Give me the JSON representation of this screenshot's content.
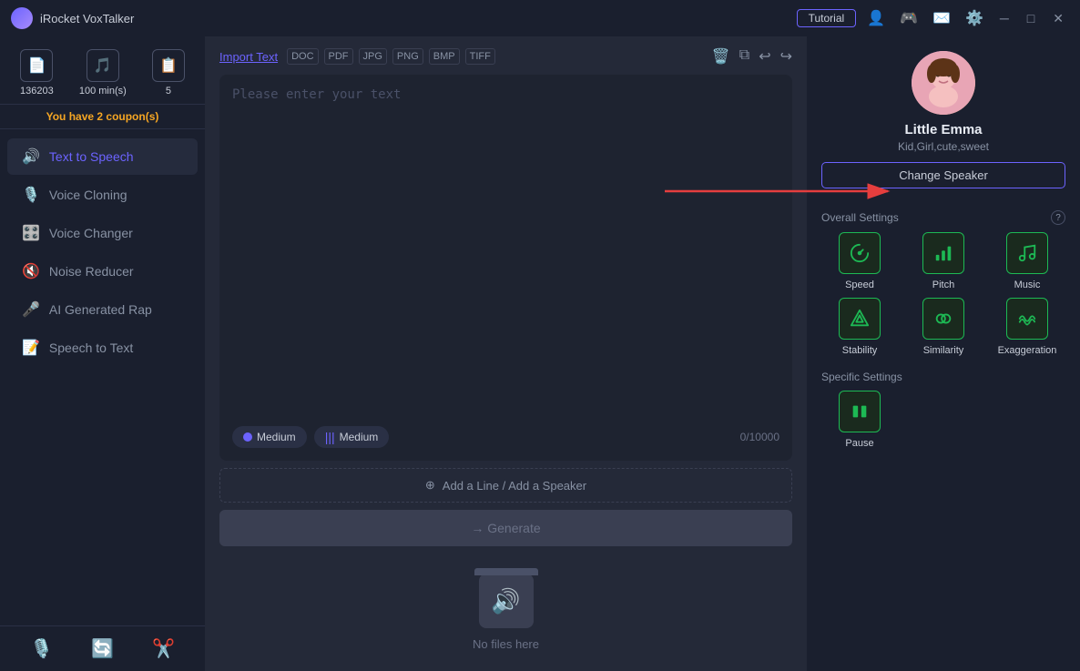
{
  "titleBar": {
    "appName": "iRocket VoxTalker",
    "tutorialBtn": "Tutorial"
  },
  "sidebar": {
    "stats": [
      {
        "value": "136203",
        "icon": "📄"
      },
      {
        "value": "100 min(s)",
        "icon": "🎵"
      },
      {
        "value": "5",
        "icon": "📋"
      }
    ],
    "coupon": "You have 2 coupon(s)",
    "navItems": [
      {
        "label": "Text to Speech",
        "icon": "🔊",
        "active": true
      },
      {
        "label": "Voice Cloning",
        "icon": "🎙️",
        "active": false
      },
      {
        "label": "Voice Changer",
        "icon": "🎛️",
        "active": false
      },
      {
        "label": "Noise Reducer",
        "icon": "🔇",
        "active": false
      },
      {
        "label": "AI Generated Rap",
        "icon": "🎤",
        "active": false
      },
      {
        "label": "Speech to Text",
        "icon": "📝",
        "active": false
      }
    ],
    "bottomIcons": [
      "🎙️",
      "🔄",
      "✂️"
    ]
  },
  "editor": {
    "importText": "Import Text",
    "fileTypes": [
      "DOC",
      "PDF",
      "JPG",
      "PNG",
      "BMP",
      "TIFF"
    ],
    "placeholder": "Please enter your text",
    "speedBadge": "Medium",
    "pitchBadge": "Medium",
    "charCount": "0/10000",
    "addLine": "Add a Line / Add a Speaker",
    "generateBtn": "→ Generate"
  },
  "noFiles": {
    "text": "No files here"
  },
  "rightPanel": {
    "speakerName": "Little Emma",
    "speakerTags": "Kid,Girl,cute,sweet",
    "changeSpeakerBtn": "Change Speaker",
    "overallSettings": "Overall Settings",
    "settingItems": [
      {
        "label": "Speed",
        "icon": "speed"
      },
      {
        "label": "Pitch",
        "icon": "pitch"
      },
      {
        "label": "Music",
        "icon": "music"
      },
      {
        "label": "Stability",
        "icon": "stability"
      },
      {
        "label": "Similarity",
        "icon": "similarity"
      },
      {
        "label": "Exaggeration",
        "icon": "exaggeration"
      }
    ],
    "specificSettings": "Specific Settings",
    "specificItems": [
      {
        "label": "Pause",
        "icon": "pause"
      }
    ]
  }
}
